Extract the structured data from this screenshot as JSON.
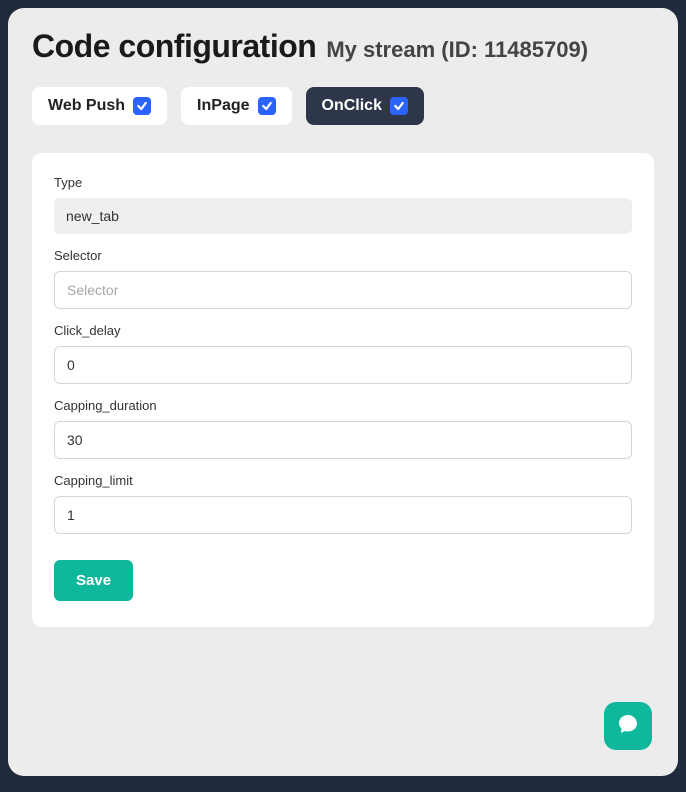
{
  "header": {
    "title": "Code configuration",
    "stream_name": "My stream",
    "id_label": "(ID: 11485709)"
  },
  "tabs": [
    {
      "label": "Web Push",
      "checked": true,
      "active": false
    },
    {
      "label": "InPage",
      "checked": true,
      "active": false
    },
    {
      "label": "OnClick",
      "checked": true,
      "active": true
    }
  ],
  "form": {
    "type_label": "Type",
    "type_value": "new_tab",
    "selector_label": "Selector",
    "selector_placeholder": "Selector",
    "selector_value": "",
    "click_delay_label": "Click_delay",
    "click_delay_value": "0",
    "capping_duration_label": "Capping_duration",
    "capping_duration_value": "30",
    "capping_limit_label": "Capping_limit",
    "capping_limit_value": "1",
    "save_label": "Save"
  },
  "icons": {
    "chat": "chat-icon"
  },
  "colors": {
    "accent": "#0fb89b",
    "checkbox": "#2b63ff",
    "tab_active_bg": "#2e3749"
  }
}
